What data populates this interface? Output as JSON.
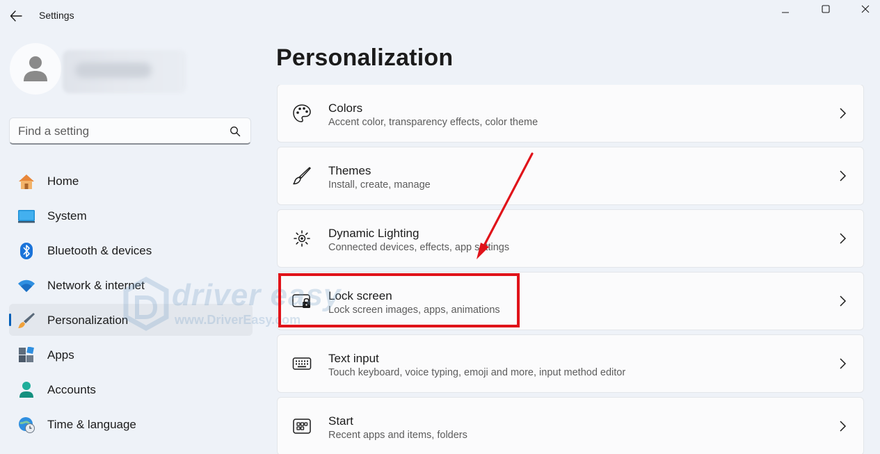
{
  "window": {
    "title": "Settings",
    "controls": {
      "minimize": "minimize-icon",
      "maximize": "maximize-icon",
      "close": "close-icon"
    }
  },
  "search": {
    "placeholder": "Find a setting"
  },
  "nav": {
    "items": [
      {
        "label": "Home",
        "icon": "home-icon"
      },
      {
        "label": "System",
        "icon": "system-icon"
      },
      {
        "label": "Bluetooth & devices",
        "icon": "bluetooth-icon"
      },
      {
        "label": "Network & internet",
        "icon": "wifi-icon"
      },
      {
        "label": "Personalization",
        "icon": "brush-icon",
        "selected": true
      },
      {
        "label": "Apps",
        "icon": "apps-icon"
      },
      {
        "label": "Accounts",
        "icon": "accounts-icon"
      },
      {
        "label": "Time & language",
        "icon": "globe-clock-icon"
      }
    ]
  },
  "main": {
    "title": "Personalization",
    "cards": [
      {
        "title": "Colors",
        "subtitle": "Accent color, transparency effects, color theme",
        "icon": "palette-icon"
      },
      {
        "title": "Themes",
        "subtitle": "Install, create, manage",
        "icon": "brush-icon"
      },
      {
        "title": "Dynamic Lighting",
        "subtitle": "Connected devices, effects, app settings",
        "icon": "sun-icon"
      },
      {
        "title": "Lock screen",
        "subtitle": "Lock screen images, apps, animations",
        "icon": "lock-screen-icon",
        "highlighted": true
      },
      {
        "title": "Text input",
        "subtitle": "Touch keyboard, voice typing, emoji and more, input method editor",
        "icon": "keyboard-icon"
      },
      {
        "title": "Start",
        "subtitle": "Recent apps and items, folders",
        "icon": "start-icon"
      }
    ]
  },
  "watermark": {
    "brand": "driver easy",
    "url": "www.DriverEasy.com"
  },
  "colors": {
    "accent": "#005fb8",
    "annotation": "#e0131a",
    "background": "#eef2f8",
    "card": "#fbfbfc"
  }
}
